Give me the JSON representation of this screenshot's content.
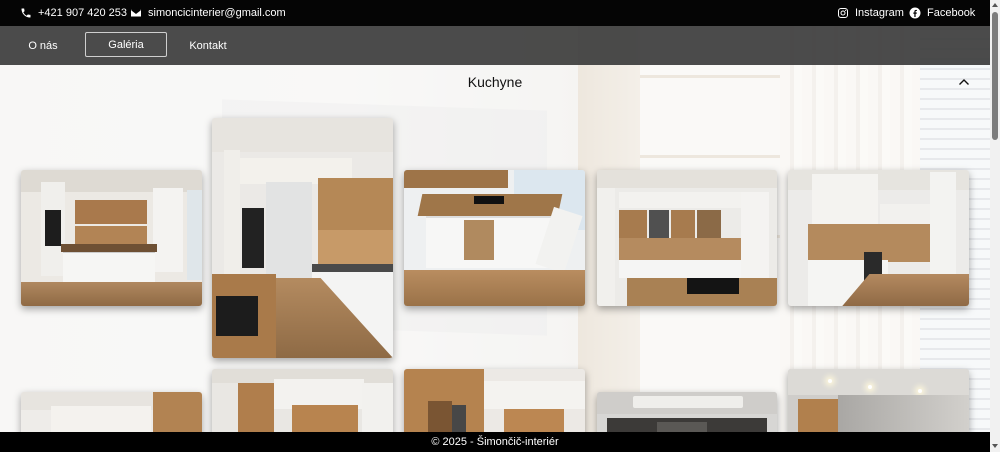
{
  "topbar": {
    "phone": "+421 907 420 253",
    "email": "simoncicinterier@gmail.com",
    "instagram": "Instagram",
    "facebook": "Facebook",
    "icons": [
      "phone-icon",
      "envelope-icon",
      "instagram-icon",
      "facebook-icon"
    ]
  },
  "nav": {
    "items": [
      {
        "label": "O nás"
      },
      {
        "label": "Galéria",
        "active": true
      },
      {
        "label": "Kontakt"
      }
    ]
  },
  "section": {
    "title": "Kuchyne",
    "toggle_icon": "chevron-up-icon"
  },
  "gallery": {
    "rows": [
      {
        "count": 5
      },
      {
        "count": 5
      }
    ]
  },
  "footer": {
    "text": "© 2025 - Šimončič-interiér"
  },
  "colors": {
    "topbar_bg": "#050505",
    "nav_bg": "#3c3c3c",
    "footer_bg": "#000000",
    "wood": "#a47a50",
    "cabinet_white": "#f2f2f0"
  }
}
